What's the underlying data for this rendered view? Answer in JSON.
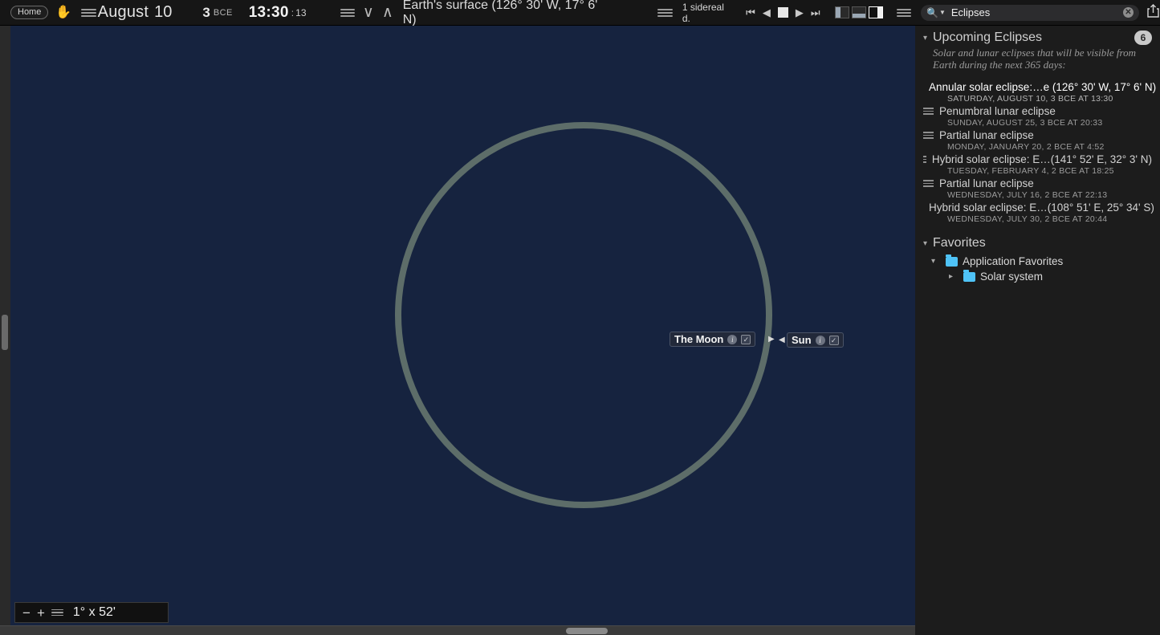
{
  "toolbar": {
    "home_label": "Home",
    "hand_icon": "hand-icon",
    "date_month": "August",
    "date_day": "10",
    "era_year": "3",
    "era_label": "BCE",
    "clock": "13:30",
    "clock_sep": ":",
    "clock_seconds": "13",
    "chevron_down": "∨",
    "chevron_up": "∧",
    "location": "Earth's surface (126° 30' W, 17° 6' N)",
    "time_rate": "1  sidereal d.",
    "transport": {
      "skip_back": "◀❚",
      "step_back": "◀",
      "stop": "stop",
      "play": "▶",
      "skip_forward": "❚▶"
    },
    "panel_buttons": [
      "left-panel",
      "bottom-panel",
      "right-panel"
    ],
    "search": {
      "value": "Eclipses",
      "placeholder": "Search",
      "clear": "✕"
    },
    "share_icon": "share-icon"
  },
  "sky": {
    "background_color": "#16233f",
    "disc_color": "#5d6d69",
    "labels": [
      {
        "name": "The Moon",
        "info": "i",
        "check": "✓",
        "pointer": "▶"
      },
      {
        "name": "Sun",
        "info": "i",
        "check": "✓",
        "pointer": "◀"
      }
    ],
    "fov": {
      "minus": "−",
      "plus": "+",
      "value": "1° x 52'"
    }
  },
  "sidebar": {
    "eclipses": {
      "title": "Upcoming Eclipses",
      "count": "6",
      "description": "Solar and lunar eclipses that will be visible from Earth during the next 365 days:",
      "items": [
        {
          "title": "Annular solar eclipse:…e (126° 30' W, 17° 6' N)",
          "date": "SATURDAY, AUGUST 10, 3 BCE AT 13:30",
          "selected": true
        },
        {
          "title": "Penumbral lunar eclipse",
          "date": "SUNDAY, AUGUST 25, 3 BCE AT 20:33",
          "selected": false
        },
        {
          "title": "Partial lunar eclipse",
          "date": "MONDAY, JANUARY 20, 2 BCE AT 4:52",
          "selected": false
        },
        {
          "title": "Hybrid solar eclipse: E…(141° 52' E, 32° 3' N)",
          "date": "TUESDAY, FEBRUARY 4, 2 BCE AT 18:25",
          "selected": false
        },
        {
          "title": "Partial lunar eclipse",
          "date": "WEDNESDAY, JULY 16, 2 BCE AT 22:13",
          "selected": false
        },
        {
          "title": "Hybrid solar eclipse: E…(108° 51' E, 25° 34' S)",
          "date": "WEDNESDAY, JULY 30, 2 BCE AT 20:44",
          "selected": false
        }
      ]
    },
    "favorites": {
      "title": "Favorites",
      "root": "Application Favorites",
      "child": "Solar system",
      "folder_color": "#4fc3f7"
    }
  }
}
